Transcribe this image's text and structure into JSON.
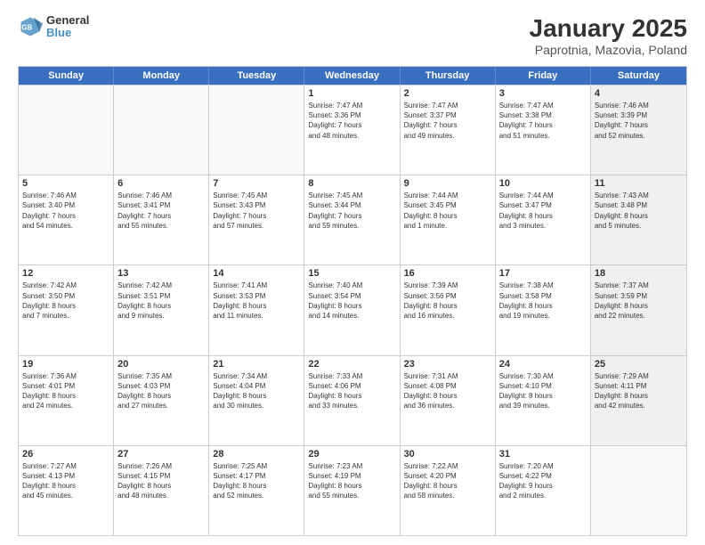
{
  "logo": {
    "line1": "General",
    "line2": "Blue"
  },
  "title": "January 2025",
  "subtitle": "Paprotnia, Mazovia, Poland",
  "header_days": [
    "Sunday",
    "Monday",
    "Tuesday",
    "Wednesday",
    "Thursday",
    "Friday",
    "Saturday"
  ],
  "weeks": [
    [
      {
        "day": "",
        "info": "",
        "empty": true
      },
      {
        "day": "",
        "info": "",
        "empty": true
      },
      {
        "day": "",
        "info": "",
        "empty": true
      },
      {
        "day": "1",
        "info": "Sunrise: 7:47 AM\nSunset: 3:36 PM\nDaylight: 7 hours\nand 48 minutes."
      },
      {
        "day": "2",
        "info": "Sunrise: 7:47 AM\nSunset: 3:37 PM\nDaylight: 7 hours\nand 49 minutes."
      },
      {
        "day": "3",
        "info": "Sunrise: 7:47 AM\nSunset: 3:38 PM\nDaylight: 7 hours\nand 51 minutes."
      },
      {
        "day": "4",
        "info": "Sunrise: 7:46 AM\nSunset: 3:39 PM\nDaylight: 7 hours\nand 52 minutes.",
        "shaded": true
      }
    ],
    [
      {
        "day": "5",
        "info": "Sunrise: 7:46 AM\nSunset: 3:40 PM\nDaylight: 7 hours\nand 54 minutes."
      },
      {
        "day": "6",
        "info": "Sunrise: 7:46 AM\nSunset: 3:41 PM\nDaylight: 7 hours\nand 55 minutes."
      },
      {
        "day": "7",
        "info": "Sunrise: 7:45 AM\nSunset: 3:43 PM\nDaylight: 7 hours\nand 57 minutes."
      },
      {
        "day": "8",
        "info": "Sunrise: 7:45 AM\nSunset: 3:44 PM\nDaylight: 7 hours\nand 59 minutes."
      },
      {
        "day": "9",
        "info": "Sunrise: 7:44 AM\nSunset: 3:45 PM\nDaylight: 8 hours\nand 1 minute."
      },
      {
        "day": "10",
        "info": "Sunrise: 7:44 AM\nSunset: 3:47 PM\nDaylight: 8 hours\nand 3 minutes."
      },
      {
        "day": "11",
        "info": "Sunrise: 7:43 AM\nSunset: 3:48 PM\nDaylight: 8 hours\nand 5 minutes.",
        "shaded": true
      }
    ],
    [
      {
        "day": "12",
        "info": "Sunrise: 7:42 AM\nSunset: 3:50 PM\nDaylight: 8 hours\nand 7 minutes."
      },
      {
        "day": "13",
        "info": "Sunrise: 7:42 AM\nSunset: 3:51 PM\nDaylight: 8 hours\nand 9 minutes."
      },
      {
        "day": "14",
        "info": "Sunrise: 7:41 AM\nSunset: 3:53 PM\nDaylight: 8 hours\nand 11 minutes."
      },
      {
        "day": "15",
        "info": "Sunrise: 7:40 AM\nSunset: 3:54 PM\nDaylight: 8 hours\nand 14 minutes."
      },
      {
        "day": "16",
        "info": "Sunrise: 7:39 AM\nSunset: 3:56 PM\nDaylight: 8 hours\nand 16 minutes."
      },
      {
        "day": "17",
        "info": "Sunrise: 7:38 AM\nSunset: 3:58 PM\nDaylight: 8 hours\nand 19 minutes."
      },
      {
        "day": "18",
        "info": "Sunrise: 7:37 AM\nSunset: 3:59 PM\nDaylight: 8 hours\nand 22 minutes.",
        "shaded": true
      }
    ],
    [
      {
        "day": "19",
        "info": "Sunrise: 7:36 AM\nSunset: 4:01 PM\nDaylight: 8 hours\nand 24 minutes."
      },
      {
        "day": "20",
        "info": "Sunrise: 7:35 AM\nSunset: 4:03 PM\nDaylight: 8 hours\nand 27 minutes."
      },
      {
        "day": "21",
        "info": "Sunrise: 7:34 AM\nSunset: 4:04 PM\nDaylight: 8 hours\nand 30 minutes."
      },
      {
        "day": "22",
        "info": "Sunrise: 7:33 AM\nSunset: 4:06 PM\nDaylight: 8 hours\nand 33 minutes."
      },
      {
        "day": "23",
        "info": "Sunrise: 7:31 AM\nSunset: 4:08 PM\nDaylight: 8 hours\nand 36 minutes."
      },
      {
        "day": "24",
        "info": "Sunrise: 7:30 AM\nSunset: 4:10 PM\nDaylight: 8 hours\nand 39 minutes."
      },
      {
        "day": "25",
        "info": "Sunrise: 7:29 AM\nSunset: 4:11 PM\nDaylight: 8 hours\nand 42 minutes.",
        "shaded": true
      }
    ],
    [
      {
        "day": "26",
        "info": "Sunrise: 7:27 AM\nSunset: 4:13 PM\nDaylight: 8 hours\nand 45 minutes."
      },
      {
        "day": "27",
        "info": "Sunrise: 7:26 AM\nSunset: 4:15 PM\nDaylight: 8 hours\nand 48 minutes."
      },
      {
        "day": "28",
        "info": "Sunrise: 7:25 AM\nSunset: 4:17 PM\nDaylight: 8 hours\nand 52 minutes."
      },
      {
        "day": "29",
        "info": "Sunrise: 7:23 AM\nSunset: 4:19 PM\nDaylight: 8 hours\nand 55 minutes."
      },
      {
        "day": "30",
        "info": "Sunrise: 7:22 AM\nSunset: 4:20 PM\nDaylight: 8 hours\nand 58 minutes."
      },
      {
        "day": "31",
        "info": "Sunrise: 7:20 AM\nSunset: 4:22 PM\nDaylight: 9 hours\nand 2 minutes."
      },
      {
        "day": "",
        "info": "",
        "empty": true,
        "shaded": true
      }
    ]
  ]
}
